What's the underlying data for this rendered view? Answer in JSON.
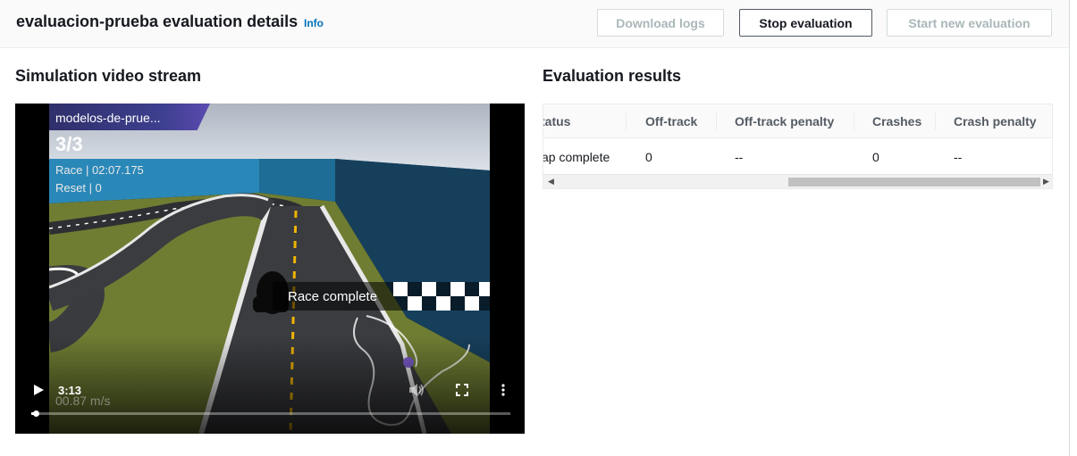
{
  "header": {
    "title": "evaluacion-prueba evaluation details",
    "info_label": "Info",
    "buttons": {
      "download_logs": "Download logs",
      "stop_evaluation": "Stop evaluation",
      "start_new_evaluation": "Start new evaluation"
    }
  },
  "simulation": {
    "heading": "Simulation video stream",
    "overlay": {
      "model_name": "modelos-de-prue...",
      "lap": "3/3",
      "race_time": "Race | 02:07.175",
      "reset": "Reset | 0",
      "speed": "00.87 m/s",
      "race_complete": "Race complete"
    },
    "player": {
      "time": "3:13",
      "progress": 0.01
    }
  },
  "evaluation": {
    "heading": "Evaluation results",
    "columns": [
      "tatus",
      "Off-track",
      "Off-track penalty",
      "Crashes",
      "Crash penalty"
    ],
    "rows": [
      [
        "ap complete",
        "0",
        "--",
        "0",
        "--"
      ]
    ]
  },
  "colors": {
    "primary_link": "#0073bb",
    "overlay_banner": "#3d3f8f",
    "grass": "#6b7a30",
    "wall": "#1f5f8a"
  }
}
